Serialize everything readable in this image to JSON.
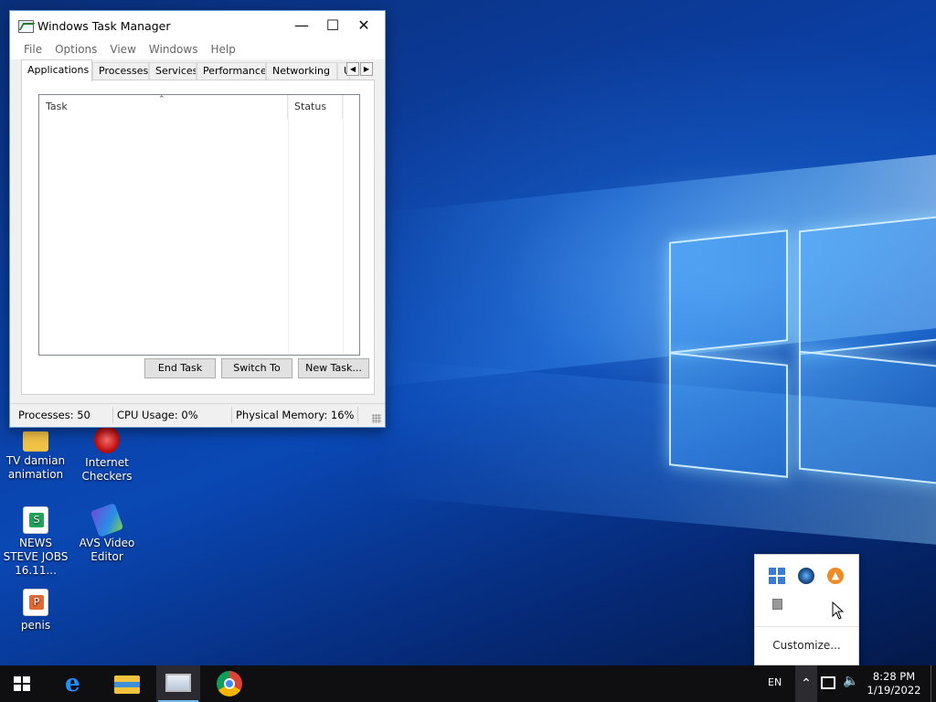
{
  "window": {
    "title": "Windows Task Manager",
    "menu": [
      "File",
      "Options",
      "View",
      "Windows",
      "Help"
    ],
    "tabs": [
      "Applications",
      "Processes",
      "Services",
      "Performance",
      "Networking",
      "U"
    ],
    "active_tab": "Applications",
    "columns": {
      "task": "Task",
      "status": "Status"
    },
    "buttons": {
      "end_task": "End Task",
      "switch_to": "Switch To",
      "new_task": "New Task..."
    },
    "status": {
      "processes": "Processes: 50",
      "cpu": "CPU Usage: 0%",
      "memory": "Physical Memory: 16%"
    }
  },
  "desktop_icons": [
    {
      "label": "TV  damian animation",
      "icon": "folder-icon"
    },
    {
      "label": "Internet Checkers",
      "icon": "internet-checkers-icon"
    },
    {
      "label": "NEWS STEVE JOBS 16.11...",
      "icon": "spreadsheet-icon"
    },
    {
      "label": "AVS Video Editor",
      "icon": "avs-video-editor-icon"
    },
    {
      "label": "penis",
      "icon": "presentation-icon"
    }
  ],
  "tray_popup": {
    "customize": "Customize..."
  },
  "taskbar": {
    "language": "EN",
    "time": "8:28 PM",
    "date": "1/19/2022"
  },
  "colors": {
    "accent": "#76b9ed",
    "taskbar": "#0f0f12",
    "title_border": "#6c9ccf"
  }
}
